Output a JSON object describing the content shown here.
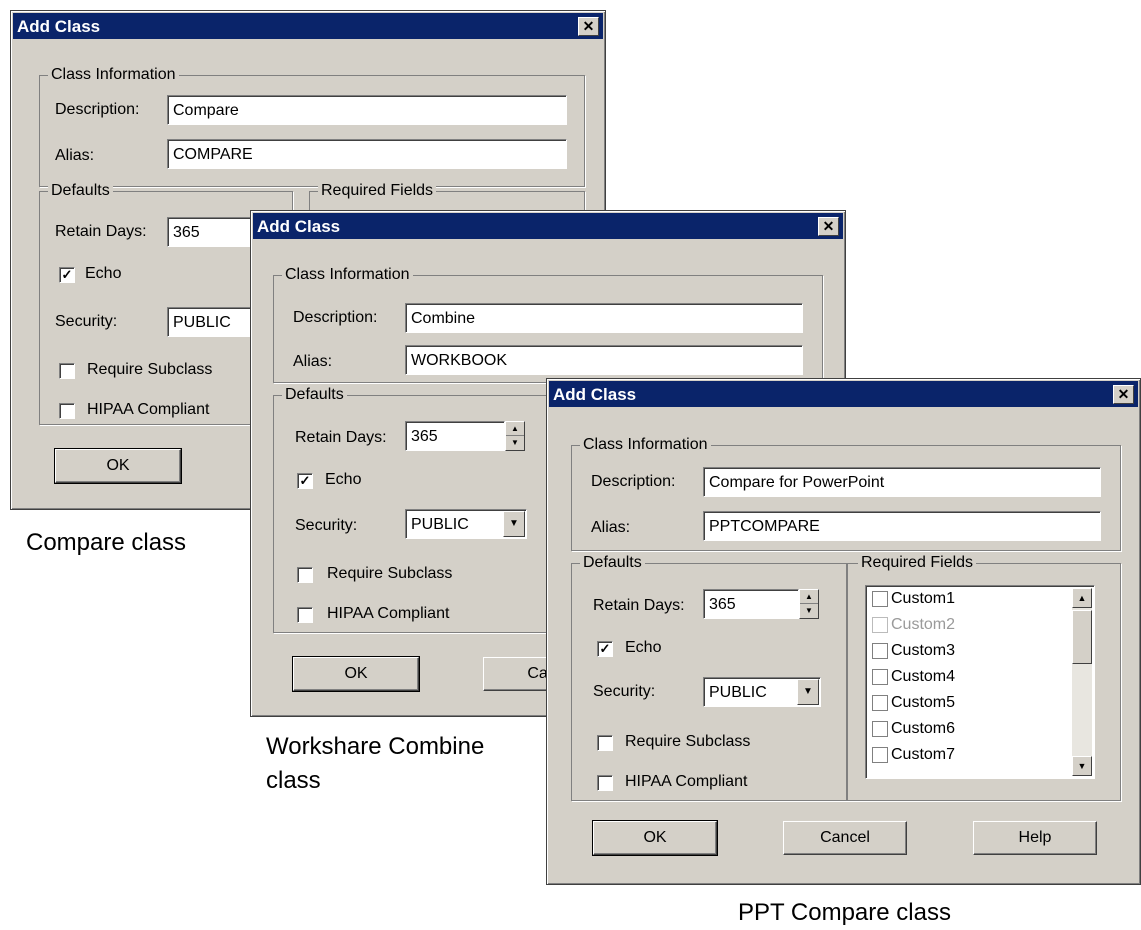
{
  "dialogs": [
    {
      "title": "Add Class",
      "close_label": "✕",
      "group_class_info": "Class Information",
      "description_label": "Description:",
      "description_value": "Compare",
      "alias_label": "Alias:",
      "alias_value": "COMPARE",
      "group_defaults": "Defaults",
      "group_required": "Required Fields",
      "retain_days_label": "Retain Days:",
      "retain_days_value": "365",
      "echo_label": "Echo",
      "echo_checked": true,
      "security_label": "Security:",
      "security_value": "PUBLIC",
      "require_subclass_label": "Require Subclass",
      "hipaa_label": "HIPAA Compliant",
      "ok_label": "OK",
      "caption": "Compare class"
    },
    {
      "title": "Add Class",
      "close_label": "✕",
      "group_class_info": "Class Information",
      "description_label": "Description:",
      "description_value": "Combine",
      "alias_label": "Alias:",
      "alias_value": "WORKBOOK",
      "group_defaults": "Defaults",
      "retain_days_label": "Retain Days:",
      "retain_days_value": "365",
      "echo_label": "Echo",
      "echo_checked": true,
      "security_label": "Security:",
      "security_value": "PUBLIC",
      "require_subclass_label": "Require Subclass",
      "hipaa_label": "HIPAA Compliant",
      "ok_label": "OK",
      "cancel_partial": "Canc",
      "caption_line1": "Workshare Combine",
      "caption_line2": "class"
    },
    {
      "title": "Add Class",
      "close_label": "✕",
      "group_class_info": "Class Information",
      "description_label": "Description:",
      "description_value": "Compare for PowerPoint",
      "alias_label": "Alias:",
      "alias_value": "PPTCOMPARE",
      "group_defaults": "Defaults",
      "group_required": "Required Fields",
      "retain_days_label": "Retain Days:",
      "retain_days_value": "365",
      "echo_label": "Echo",
      "echo_checked": true,
      "security_label": "Security:",
      "security_value": "PUBLIC",
      "require_subclass_label": "Require Subclass",
      "hipaa_label": "HIPAA Compliant",
      "required_fields": [
        "Custom1",
        "Custom2",
        "Custom3",
        "Custom4",
        "Custom5",
        "Custom6",
        "Custom7"
      ],
      "required_fields_disabled": [
        "Custom2"
      ],
      "ok_label": "OK",
      "cancel_label": "Cancel",
      "help_label": "Help",
      "caption": "PPT Compare class"
    }
  ],
  "colors": {
    "titlebar": "#0a246a",
    "dialog_bg": "#d4d0c8"
  }
}
